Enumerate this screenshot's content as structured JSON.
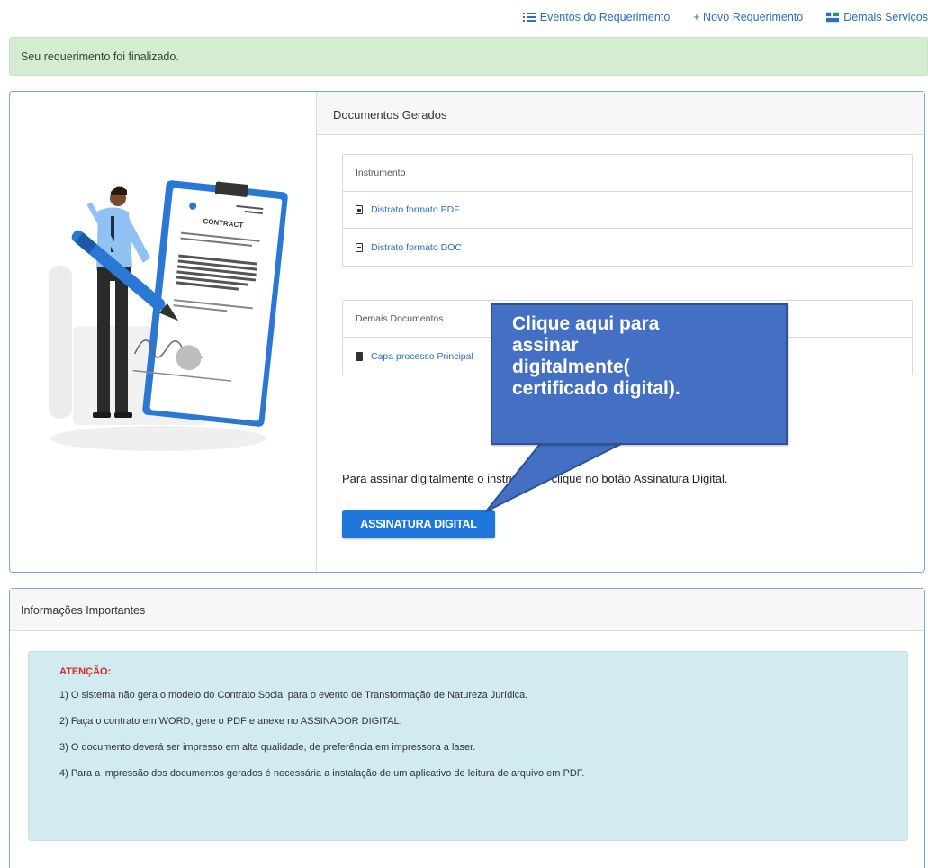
{
  "topnav": {
    "events": {
      "label": "Eventos do Requerimento",
      "icon": "list-icon"
    },
    "new_request": {
      "label": "+ Novo Requerimento"
    },
    "other_services": {
      "label": "Demais Serviços",
      "icon": "services-icon"
    }
  },
  "alert": {
    "message": "Seu requerimento foi finalizado."
  },
  "illustration": {
    "contract_text": "CONTRACT"
  },
  "documents": {
    "title": "Documentos Gerados",
    "instrument": {
      "header": "Instrumento",
      "items": [
        {
          "label": "Distrato formato PDF",
          "icon": "file-icon"
        },
        {
          "label": "Distrato formato DOC",
          "icon": "file-icon"
        }
      ]
    },
    "others": {
      "header": "Demais Documentos",
      "items": [
        {
          "label": "Capa processo Principal",
          "icon": "file-icon"
        }
      ]
    },
    "instruction": "Para assinar digitalmente o instrumento clique no botão Assinatura Digital.",
    "sign_button": "ASSINATURA DIGITAL"
  },
  "callout": {
    "lines": [
      "Clique aqui para",
      "assinar",
      "digitalmente(",
      "certificado digital)."
    ],
    "colors": {
      "fill": "#4470c4",
      "border": "#2d5192"
    }
  },
  "info": {
    "title": "Informações Importantes",
    "attention": "ATENÇÃO:",
    "items": [
      "1) O sistema não gera o modelo do Contrato Social para o evento de Transformação de Natureza Jurídica.",
      "2) Faça o contrato em WORD, gere o PDF e anexe no ASSINADOR DIGITAL.",
      "3) O documento deverá ser impresso em alta qualidade, de preferência em impressora a laser.",
      "4) Para a impressão dos documentos gerados é necessária a instalação de um aplicativo de leitura de arquivo em PDF."
    ]
  },
  "colors": {
    "link": "#2a6fc0",
    "primary": "#2077db",
    "success_bg": "#d4ecd2",
    "info_bg": "#d2ebf1",
    "danger": "#d22b2b",
    "card_border": "#76a9d8"
  }
}
